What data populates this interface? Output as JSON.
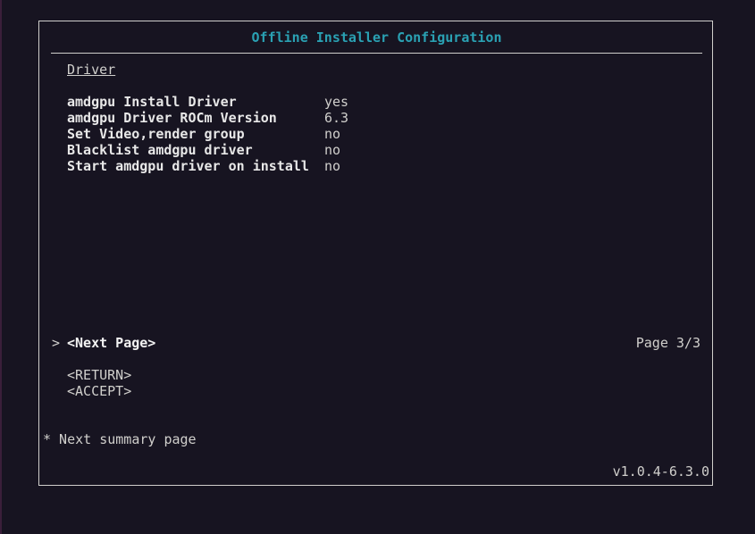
{
  "window": {
    "title": "Offline Installer Configuration"
  },
  "section": {
    "name": "Driver"
  },
  "settings": [
    {
      "label": "amdgpu Install Driver",
      "value": "yes"
    },
    {
      "label": "amdgpu Driver ROCm Version",
      "value": "6.3"
    },
    {
      "label": "Set Video,render group",
      "value": "no"
    },
    {
      "label": "Blacklist amdgpu driver",
      "value": "no"
    },
    {
      "label": "Start amdgpu driver on install",
      "value": "no"
    }
  ],
  "navigation": {
    "cursor": ">",
    "next_page_label": "<Next Page>",
    "page_indicator": "Page 3/3",
    "return_label": "<RETURN>",
    "accept_label": "<ACCEPT>"
  },
  "help_text": "* Next summary page",
  "version": "v1.0.4-6.3.0",
  "colors": {
    "background": "#171421",
    "foreground": "#d0cfcc",
    "title": "#2aa1b3"
  }
}
